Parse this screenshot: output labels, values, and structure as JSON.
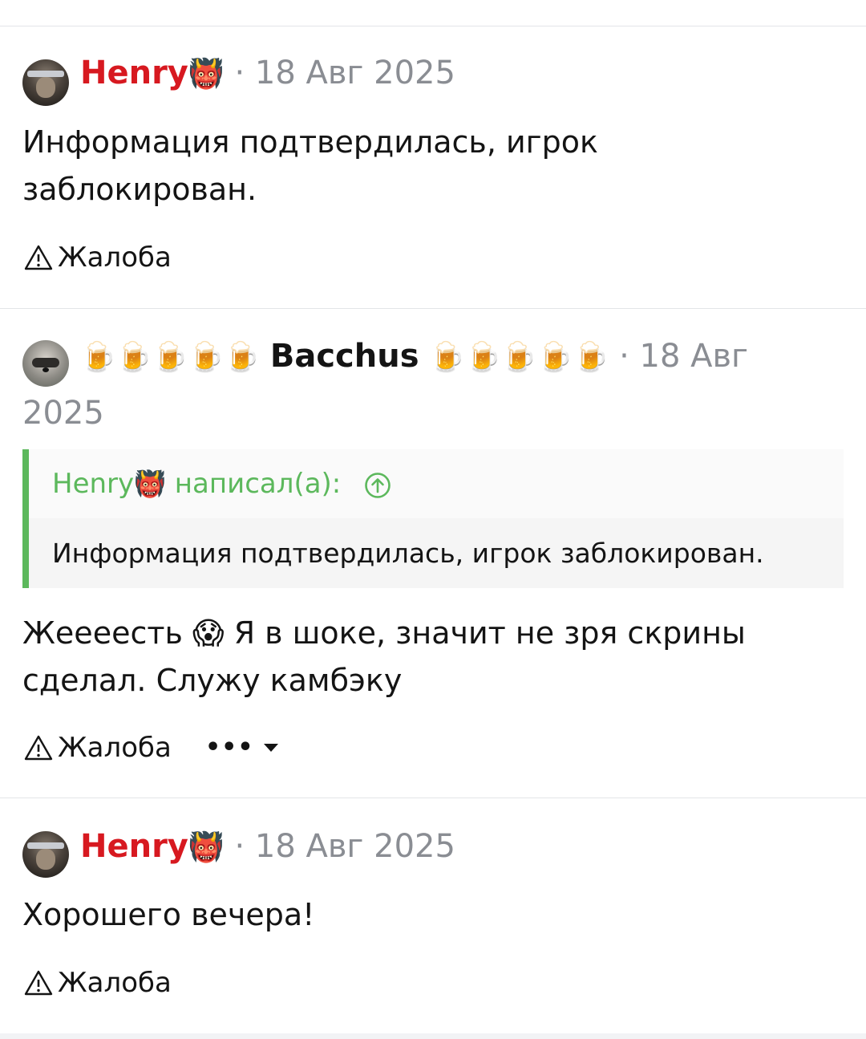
{
  "posts": [
    {
      "username": "Henry",
      "user_emoji": "👹",
      "date": "· 18 Авг 2025",
      "message": "Информация подтвердилась, игрок заблокирован.",
      "report_label": "Жалоба"
    },
    {
      "username": "Bacchus",
      "beers_left": "🍺🍺🍺🍺🍺",
      "beers_right": "🍺🍺🍺🍺🍺",
      "date_part1": "· 18 Авг",
      "date_part2": "2025",
      "quote": {
        "author": "Henry",
        "author_emoji": "👹",
        "wrote_label": "написал(а):",
        "text": "Информация подтвердилась, игрок заблокирован."
      },
      "message_line1_a": "Жеееесть",
      "message_emoji": "😱",
      "message_line1_b": "Я в шоке, значит не зря скрины",
      "message_line2": "сделал. Служу камбэку",
      "report_label": "Жалоба",
      "more_label": "•••"
    },
    {
      "username": "Henry",
      "user_emoji": "👹",
      "date": "· 18 Авг 2025",
      "message": "Хорошего вечера!",
      "report_label": "Жалоба"
    }
  ],
  "colors": {
    "username_red": "#d71920",
    "quote_accent": "#5cb85c",
    "meta_gray": "#8a8d93"
  },
  "icons": [
    "warning-triangle-icon",
    "arrow-up-circle-icon",
    "more-dots-icon",
    "caret-down-icon"
  ]
}
